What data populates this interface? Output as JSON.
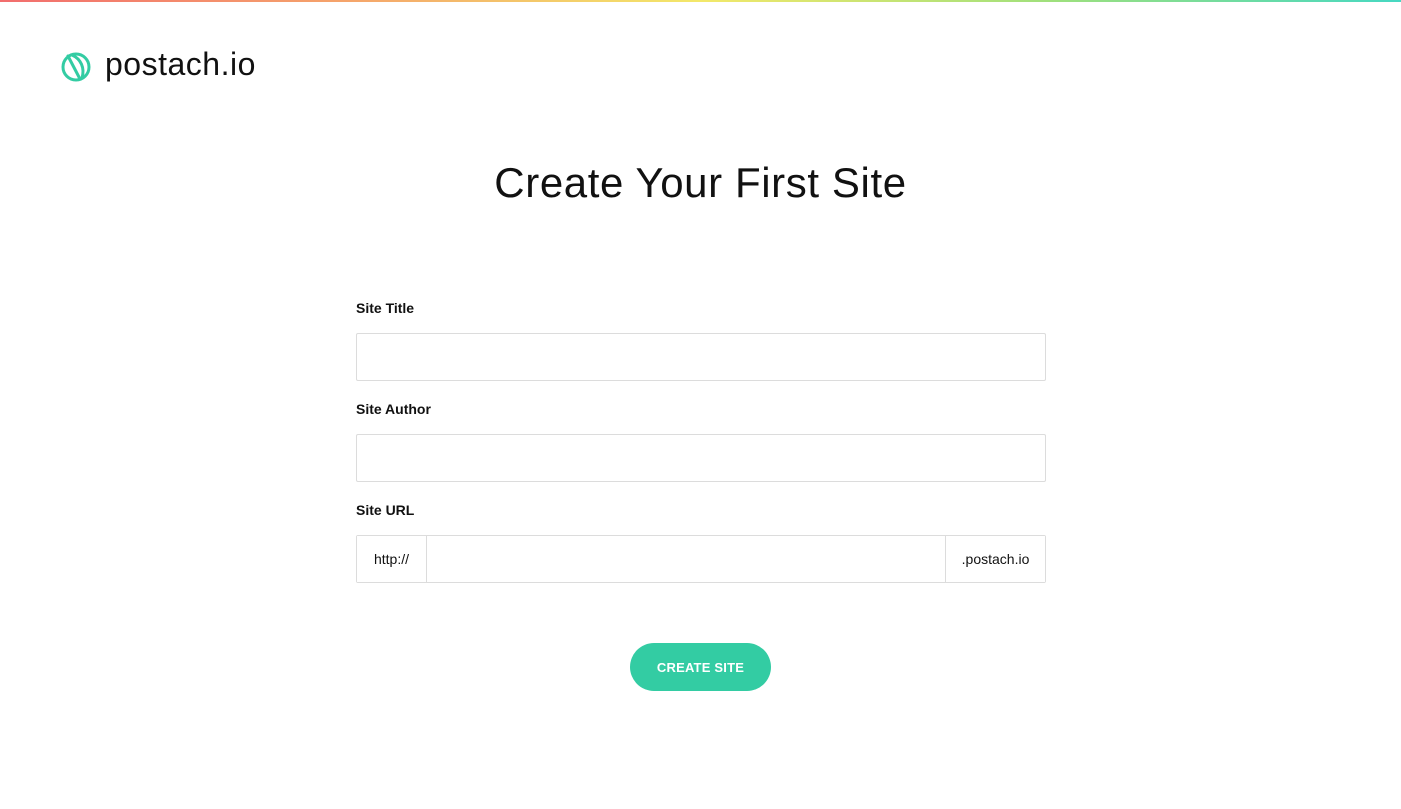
{
  "brand": {
    "name": "postach.io",
    "logo_icon": "postachio-leaf-icon",
    "accent_color": "#33cca3"
  },
  "page": {
    "title": "Create Your First Site"
  },
  "form": {
    "site_title": {
      "label": "Site Title",
      "value": "",
      "placeholder": ""
    },
    "site_author": {
      "label": "Site Author",
      "value": "",
      "placeholder": ""
    },
    "site_url": {
      "label": "Site URL",
      "prefix": "http://",
      "suffix": ".postach.io",
      "value": "",
      "placeholder": ""
    },
    "submit_label": "CREATE SITE"
  }
}
